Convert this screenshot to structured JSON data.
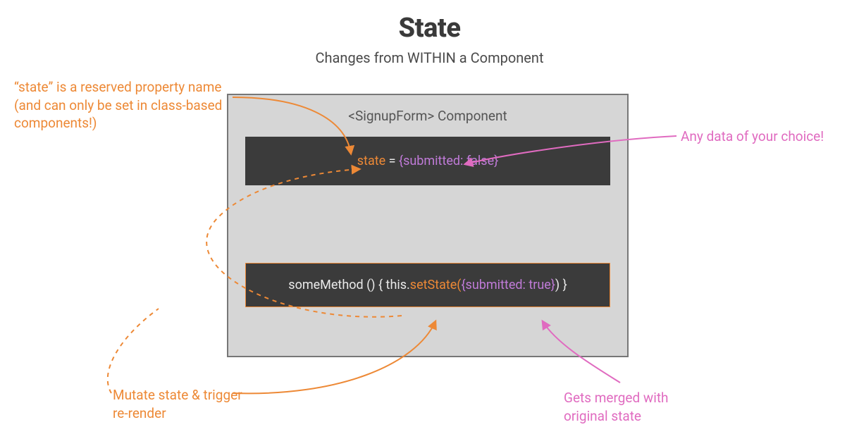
{
  "title": "State",
  "subtitle": "Changes from WITHIN a Component",
  "component": {
    "label": "<SignupForm> Component",
    "code1": {
      "state": "state",
      "equals": " = ",
      "value": "{submitted: false}"
    },
    "code2": {
      "pre": "someMethod () { this.",
      "setState": "setState(",
      "arg": "{submitted: true}",
      "post": ") }"
    }
  },
  "annotations": {
    "reserved": "“state” is a reserved property name (and can only be set in class-based components!)",
    "any_data": "Any data of your choice!",
    "mutate": "Mutate state & trigger re-render",
    "merged": "Gets merged with original state"
  },
  "colors": {
    "orange": "#ed8936",
    "pink": "#e06bc0",
    "purple": "#c07bd8",
    "code_bg": "#3b3b3b",
    "box_bg": "#d6d6d6"
  }
}
